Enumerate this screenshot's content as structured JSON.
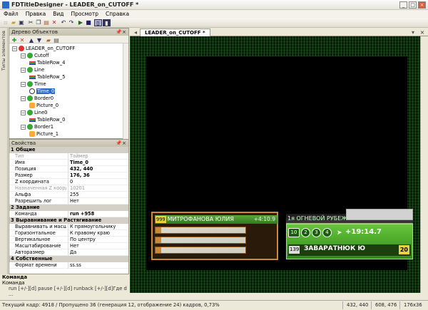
{
  "window": {
    "title": "FDTitleDesigner - LEADER_on_CUTOFF *",
    "controls": [
      "_",
      "□",
      "×"
    ]
  },
  "menu": [
    "Файл",
    "Правка",
    "Вид",
    "Просмотр",
    "Справка"
  ],
  "lefttab": {
    "label": "Типы элементов"
  },
  "tree": {
    "header": "Дерево Объектов",
    "nodes": [
      {
        "label": "LEADER_on_CUTOFF",
        "icon": "project-icon",
        "level": 0
      },
      {
        "label": "Cutoff",
        "icon": "group-icon",
        "level": 1
      },
      {
        "label": "TableRow_4",
        "icon": "table-row-icon",
        "level": 2
      },
      {
        "label": "Line",
        "icon": "group-icon",
        "level": 1
      },
      {
        "label": "TableRow_5",
        "icon": "table-row-icon",
        "level": 2
      },
      {
        "label": "Time",
        "icon": "group-icon",
        "level": 1
      },
      {
        "label": "Time_0",
        "icon": "clock-icon",
        "level": 2,
        "selected": true
      },
      {
        "label": "Border0",
        "icon": "group-icon",
        "level": 1
      },
      {
        "label": "Picture_0",
        "icon": "picture-icon",
        "level": 2
      },
      {
        "label": "Line0",
        "icon": "group-icon",
        "level": 1
      },
      {
        "label": "TableRow_0",
        "icon": "table-row-icon",
        "level": 2
      },
      {
        "label": "Border1",
        "icon": "group-icon",
        "level": 1
      },
      {
        "label": "Picture_1",
        "icon": "picture-icon",
        "level": 2
      }
    ]
  },
  "props": {
    "header": "Свойства",
    "rows": [
      {
        "type": "cat",
        "k": "1 Общие"
      },
      {
        "k": "Тип",
        "v": "Таймер",
        "dis": true
      },
      {
        "k": "Имя",
        "v": "Time_0",
        "b": true
      },
      {
        "k": "Позиция",
        "v": "432, 440",
        "b": true
      },
      {
        "k": "Размер",
        "v": "176, 36",
        "b": true
      },
      {
        "k": "Z координата",
        "v": "0"
      },
      {
        "k": "Назначенная Z коорд",
        "v": "10201",
        "dis": true
      },
      {
        "k": "Альфа",
        "v": "255"
      },
      {
        "k": "Разрешить лог",
        "v": "Нет"
      },
      {
        "type": "cat",
        "k": "2 Задание"
      },
      {
        "k": "Команда",
        "v": "run +958",
        "b": true
      },
      {
        "type": "cat",
        "k": "3 Выравнивание и Растягивание"
      },
      {
        "k": "Выравнивать и масшт",
        "v": "К прямоугольнику"
      },
      {
        "k": "Горизонтальное",
        "v": "К правому краю"
      },
      {
        "k": "Вертикальное",
        "v": "По центру"
      },
      {
        "k": "Масштабирование",
        "v": "Нет"
      },
      {
        "k": "Авторазмер",
        "v": "Да"
      },
      {
        "type": "cat",
        "k": "4 Собственные"
      },
      {
        "k": "Формат времени",
        "v": "ss.ss"
      }
    ]
  },
  "cmd": {
    "title": "Команда",
    "sub": "Команда",
    "hint": "run [+/-][d]  pause [+/-][d]  runback [+/-][d]Где d ..."
  },
  "doc": {
    "tab": "LEADER_on_CUTOFF *"
  },
  "scene": {
    "bar1": {
      "num": "999",
      "name": "МИТРОФАНОВА ЮЛИЯ",
      "time": "+4:10.9",
      "rows": [
        "",
        "",
        ""
      ]
    },
    "bar2": {
      "lineup": "1я ОГНЕВОЙ РУБЕЖ",
      "shots": [
        "10",
        "2",
        "3",
        "4"
      ],
      "time": "+19:14.7",
      "num": "139",
      "name": "ЗАВАРАТНЮК Ю",
      "pts": "20"
    }
  },
  "status": {
    "frame": "Текущий кадр: 4918 / Пропущено 36 (генерация 12, отображение 24) кадров, 0,73%",
    "pos": "432, 440",
    "pos2": "608, 476",
    "size": "176x36"
  },
  "colors": {
    "accent": "#316ac5",
    "green": "#4ca82a",
    "gold": "#c98a3a"
  }
}
